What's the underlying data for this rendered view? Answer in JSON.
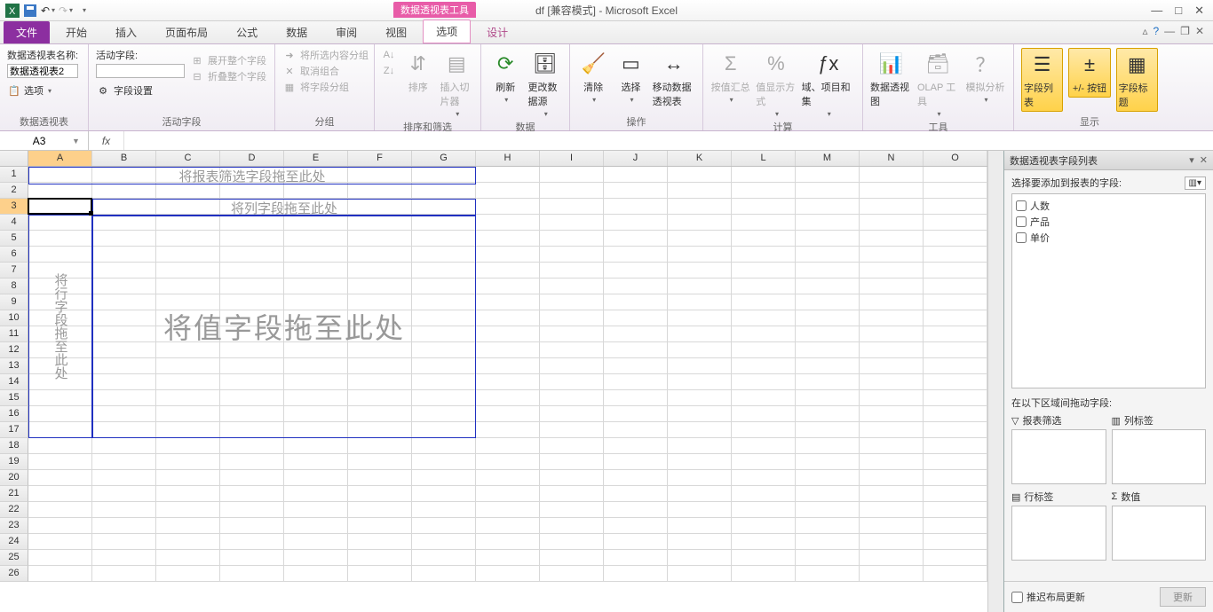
{
  "title": "df  [兼容模式] - Microsoft Excel",
  "context_tab": "数据透视表工具",
  "tabs": {
    "file": "文件",
    "home": "开始",
    "insert": "插入",
    "layout": "页面布局",
    "formulas": "公式",
    "data": "数据",
    "review": "审阅",
    "view": "视图",
    "options": "选项",
    "design": "设计"
  },
  "ribbon": {
    "pt": {
      "name_label": "数据透视表名称:",
      "name_value": "数据透视表2",
      "options": "选项",
      "group": "数据透视表"
    },
    "active_field": {
      "label": "活动字段:",
      "settings": "字段设置",
      "expand": "展开整个字段",
      "collapse": "折叠整个字段",
      "group": "活动字段"
    },
    "grouping": {
      "sel": "将所选内容分组",
      "ungroup": "取消组合",
      "field": "将字段分组",
      "group": "分组"
    },
    "sortfilter": {
      "sort": "排序",
      "slicer": "插入切片器",
      "group": "排序和筛选"
    },
    "datagrp": {
      "refresh": "刷新",
      "change": "更改数据源",
      "group": "数据"
    },
    "actions": {
      "clear": "清除",
      "select": "选择",
      "move": "移动数据透视表",
      "group": "操作"
    },
    "calc": {
      "summarize": "按值汇总",
      "show": "值显示方式",
      "fields": "域、项目和集",
      "group": "计算"
    },
    "tools": {
      "chart": "数据透视图",
      "olap": "OLAP 工具",
      "whatif": "模拟分析",
      "group": "工具"
    },
    "show": {
      "fieldlist": "字段列表",
      "pmbuttons": "+/- 按钮",
      "headers": "字段标题",
      "group": "显示"
    }
  },
  "namebox": "A3",
  "columns": [
    "A",
    "B",
    "C",
    "D",
    "E",
    "F",
    "G",
    "H",
    "I",
    "J",
    "K",
    "L",
    "M",
    "N",
    "O"
  ],
  "rows": [
    "1",
    "2",
    "3",
    "4",
    "5",
    "6",
    "7",
    "8",
    "9",
    "10",
    "11",
    "12",
    "13",
    "14",
    "15",
    "16",
    "17",
    "18",
    "19",
    "20",
    "21",
    "22",
    "23",
    "24",
    "25",
    "26"
  ],
  "pivot_placeholders": {
    "filter": "将报表筛选字段拖至此处",
    "cols": "将列字段拖至此处",
    "rows": "将行字段拖至此处",
    "values": "将值字段拖至此处"
  },
  "pane": {
    "title": "数据透视表字段列表",
    "choose": "选择要添加到报表的字段:",
    "fields": [
      "人数",
      "产品",
      "单价"
    ],
    "areas_label": "在以下区域间拖动字段:",
    "filter": "报表筛选",
    "collab": "列标签",
    "rowlab": "行标签",
    "values": "数值",
    "defer": "推迟布局更新",
    "update": "更新"
  },
  "chart_data": null
}
